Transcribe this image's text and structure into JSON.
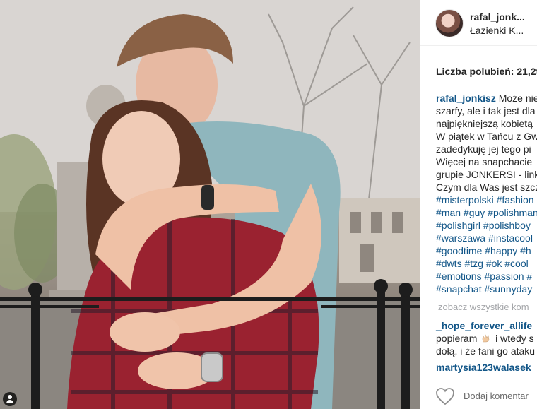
{
  "post": {
    "username": "rafal_jonk...",
    "location": "Łazienki K...",
    "likes": "Liczba polubień: 21,2t",
    "caption": {
      "author": "rafal_jonkisz",
      "lines": [
        "Może nie",
        "szarfy, ale i tak jest dla",
        "najpiękniejszą kobietą",
        "W piątek w Tańcu z Gw",
        "zadedykuję jej tego pi",
        "Więcej na snapchacie",
        "grupie JONKERSI - link",
        "Czym dla Was jest szcz"
      ],
      "hashtag_lines": [
        "#misterpolski #fashion",
        "#man #guy #polishman",
        "#polishgirl #polishboy",
        "#warszawa #instacool",
        "#goodtime #happy #h",
        "#dwts #tzg #ok #cool",
        "#emotions #passion #",
        "#snapchat #sunnyday"
      ]
    },
    "view_all_comments": "zobacz wszystkie kom",
    "comment": {
      "author": "_hope_forever_allife",
      "line1_before": "popieram",
      "line1_after": "i wtedy s",
      "line2": "dołą, i że fani go ataku"
    },
    "next_comment_author": "martysia123walasek",
    "add_comment_placeholder": "Dodaj komentar"
  },
  "icons": {
    "like": "heart-outline-icon",
    "emoji": "clapping-hands-icon",
    "photo_tag": "user-tag-icon"
  },
  "colors": {
    "link": "#125688",
    "text": "#262626",
    "muted": "#a5a7aa"
  }
}
